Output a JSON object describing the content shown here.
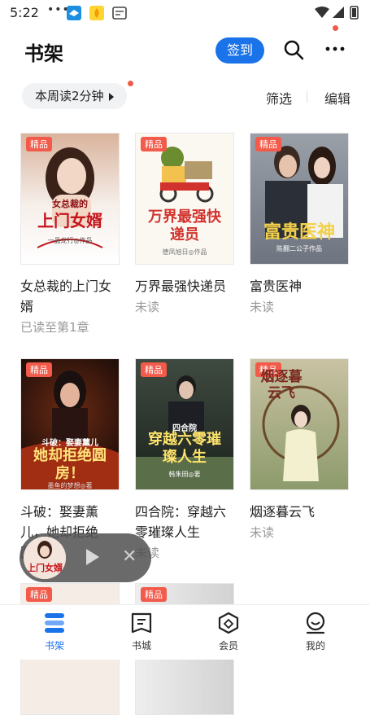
{
  "status_bar": {
    "time": "5:22",
    "dots": "•••"
  },
  "header": {
    "title": "书架",
    "signin_label": "签到"
  },
  "toolbar": {
    "read_time": "本周读2分钟",
    "filter_label": "筛选",
    "edit_label": "编辑"
  },
  "books": [
    {
      "tag": "精品",
      "name": "女总裁的上门女婿",
      "status": "已读至第1章",
      "cover_title": "上门女婿",
      "cover_top": "女总裁的",
      "cover_sub": "一品龙行◎作品"
    },
    {
      "tag": "精品",
      "name": "万界最强快递员",
      "status": "未读",
      "cover_title": "万界最强快递员",
      "cover_sub": "德凤旭日◎作品"
    },
    {
      "tag": "精品",
      "name": "富贵医神",
      "status": "未读",
      "cover_title": "富贵医神",
      "cover_sub": "陈翻二公子作品"
    },
    {
      "tag": "精品",
      "name": "斗破：娶妻薰儿，她却拒绝圆...",
      "status": "",
      "cover_title": "她却拒绝圆房！",
      "cover_top": "斗破：娶妻薰儿",
      "cover_sub": "墨鱼的梦想◎著"
    },
    {
      "tag": "精品",
      "name": "四合院：穿越六零璀璨人生",
      "status": "未读",
      "cover_title": "穿越六零璀璨人生",
      "cover_top": "四合院",
      "cover_sub": "韩朱田◎著"
    },
    {
      "tag": "精品",
      "name": "烟逐暮云飞",
      "status": "未读",
      "cover_title": "烟逐暮云飞",
      "cover_sub": ""
    },
    {
      "tag": "精品"
    },
    {
      "tag": "精品"
    }
  ],
  "floating_player": {
    "thumb_title": "上门女婿"
  },
  "bottom_nav": [
    {
      "label": "书架",
      "icon": "bookshelf-icon",
      "active": true
    },
    {
      "label": "书城",
      "icon": "bookstore-icon",
      "active": false
    },
    {
      "label": "会员",
      "icon": "vip-icon",
      "active": false
    },
    {
      "label": "我的",
      "icon": "profile-icon",
      "active": false
    }
  ],
  "colors": {
    "accent": "#1a73e8",
    "tag": "#f25a4a",
    "badge_dot": "#f05a4a"
  }
}
